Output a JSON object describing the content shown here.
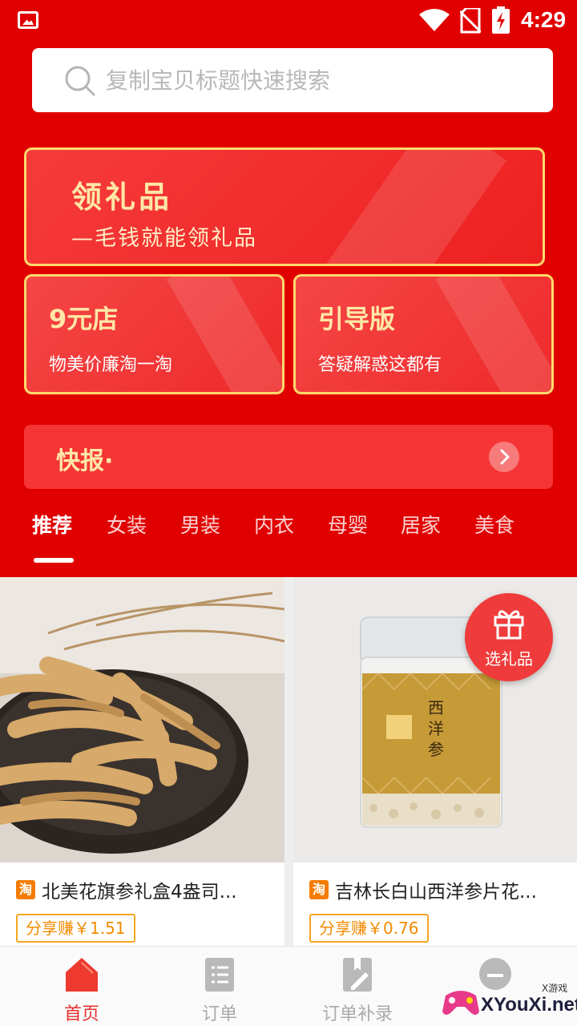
{
  "status_bar": {
    "time": "4:29"
  },
  "search": {
    "placeholder": "复制宝贝标题快速搜索"
  },
  "gift_banner": {
    "title": "领礼品",
    "subtitle": "—毛钱就能领礼品"
  },
  "cards": [
    {
      "title": "9元店",
      "subtitle": "物美价廉淘一淘"
    },
    {
      "title": "引导版",
      "subtitle": "答疑解惑这都有"
    }
  ],
  "news": {
    "label": "快报·"
  },
  "tabs": [
    "推荐",
    "女装",
    "男装",
    "内衣",
    "母婴",
    "居家",
    "美食"
  ],
  "products": [
    {
      "platform_icon": "淘",
      "name": "北美花旗参礼盒4盎司...",
      "share": "分享赚￥1.51"
    },
    {
      "platform_icon": "淘",
      "name": "吉林长白山西洋参片花...",
      "share": "分享赚￥0.76"
    }
  ],
  "gift_fab": {
    "label": "选礼品"
  },
  "bottom_nav": [
    {
      "label": "首页",
      "icon": "home-icon",
      "active": true
    },
    {
      "label": "订单",
      "icon": "list-icon",
      "active": false
    },
    {
      "label": "订单补录",
      "icon": "edit-icon",
      "active": false
    },
    {
      "label": "",
      "icon": "profile-icon",
      "active": false
    }
  ],
  "watermark": {
    "text": "XYouXi.net",
    "small": "X游戏"
  },
  "colors": {
    "brand_red": "#e10000",
    "gold": "#ffd96b",
    "share_orange": "#f28b00"
  }
}
